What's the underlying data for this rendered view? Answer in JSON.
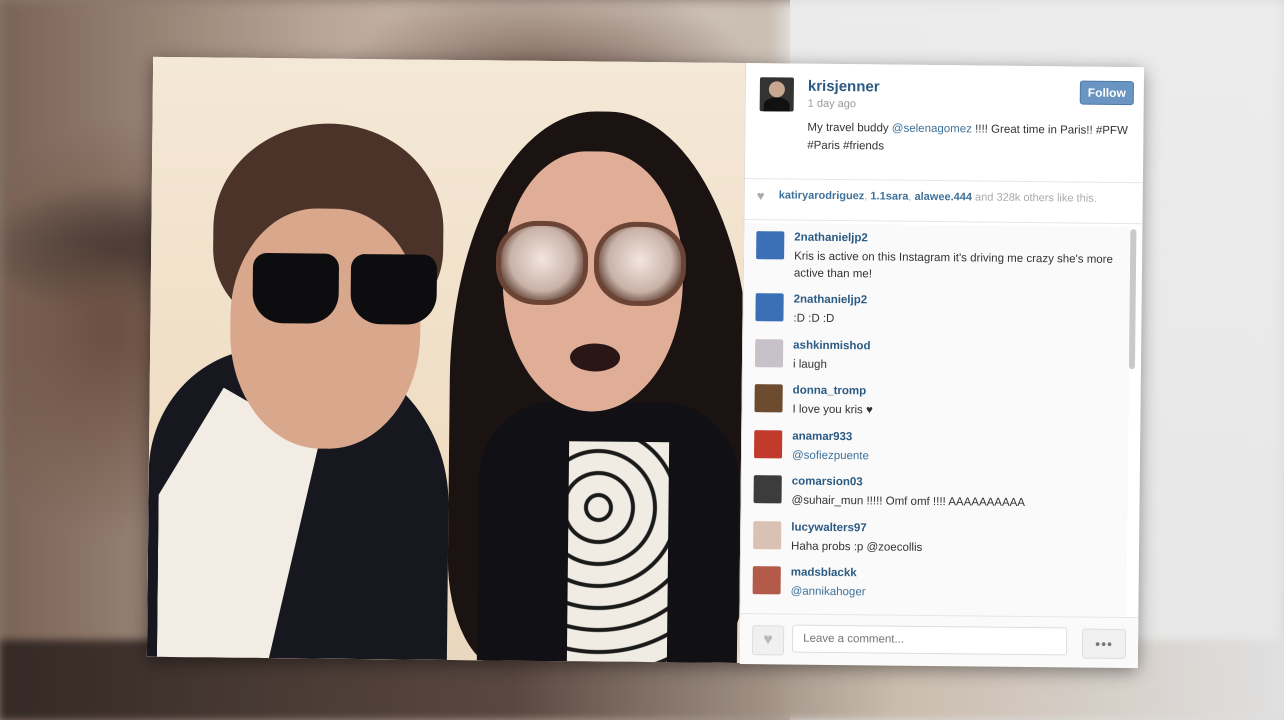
{
  "post": {
    "username": "krisjenner",
    "time": "1 day ago",
    "follow_label": "Follow",
    "caption_prefix": "My travel buddy ",
    "caption_mention": "@selenagomez",
    "caption_suffix": " !!!! Great time in Paris!! #PFW #Paris #friends"
  },
  "likes": {
    "user1": "katiryarodriguez",
    "user2": "1.1sara",
    "user3": "alawee.444",
    "rest": " and 328k others like this."
  },
  "comments": [
    {
      "user": "2nathanieljp2",
      "text": "Kris is active on this Instagram it's driving me crazy she's more active than me!",
      "avatar_color": "#3b6fb6"
    },
    {
      "user": "2nathanieljp2",
      "text": ":D :D :D",
      "avatar_color": "#3b6fb6"
    },
    {
      "user": "ashkinmishod",
      "text": "i laugh",
      "avatar_color": "#c7c2ca"
    },
    {
      "user": "donna_tromp",
      "text": "I love you kris ♥",
      "avatar_color": "#6d4b2e"
    },
    {
      "user": "anamar933",
      "text": "@sofiezpuente",
      "avatar_color": "#c23a2b",
      "mention": true
    },
    {
      "user": "comarsion03",
      "text": "@suhair_mun !!!!! Omf omf !!!! AAAAAAAAAA",
      "avatar_color": "#3c3c3c"
    },
    {
      "user": "lucywalters97",
      "text": "Haha probs :p @zoecollis",
      "avatar_color": "#d9c2b4"
    },
    {
      "user": "madsblackk",
      "text": "@annikahoger",
      "avatar_color": "#b35a4a",
      "mention": true
    }
  ],
  "footer": {
    "comment_placeholder": "Leave a comment...",
    "more_label": "•••",
    "like_icon": "heart-icon"
  }
}
